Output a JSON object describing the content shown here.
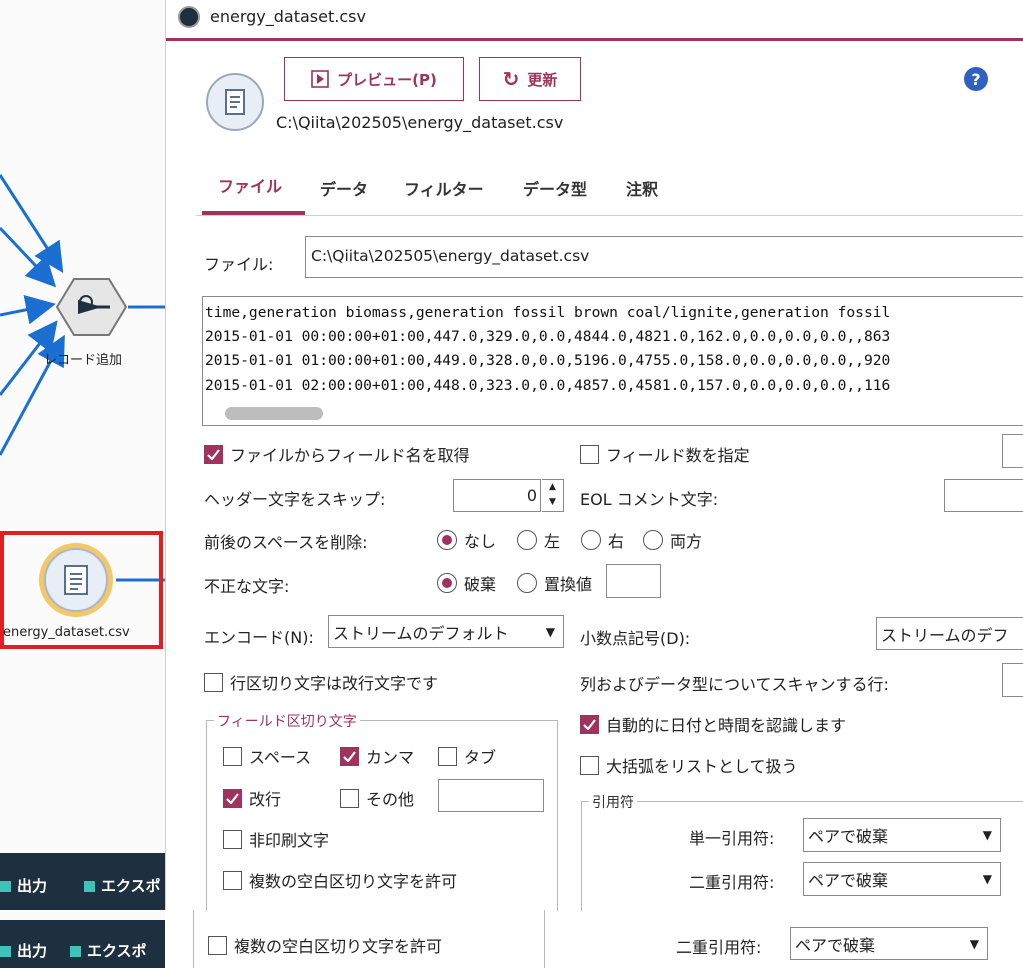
{
  "canvas": {
    "merge_node_label": "レコード追加",
    "source_node_label": "energy_dataset.csv",
    "bottom_bar": {
      "output_label": "出力",
      "export_label": "エクスポ"
    }
  },
  "window": {
    "title": "energy_dataset.csv"
  },
  "toolbar": {
    "preview_label": "プレビュー(P)",
    "refresh_label": "更新",
    "help_label": "?"
  },
  "file_path": "C:\\Qiita\\202505\\energy_dataset.csv",
  "tabs": [
    {
      "label": "ファイル"
    },
    {
      "label": "データ"
    },
    {
      "label": "フィルター"
    },
    {
      "label": "データ型"
    },
    {
      "label": "注釈"
    }
  ],
  "file_field": {
    "label": "ファイル:",
    "value": "C:\\Qiita\\202505\\energy_dataset.csv"
  },
  "preview_lines": [
    "time,generation biomass,generation fossil brown coal/lignite,generation fossil",
    "2015-01-01 00:00:00+01:00,447.0,329.0,0.0,4844.0,4821.0,162.0,0.0,0.0,0.0,,863",
    "2015-01-01 01:00:00+01:00,449.0,328.0,0.0,5196.0,4755.0,158.0,0.0,0.0,0.0,,920",
    "2015-01-01 02:00:00+01:00,448.0,323.0,0.0,4857.0,4581.0,157.0,0.0,0.0,0.0,,116"
  ],
  "options": {
    "get_field_names": {
      "label": "ファイルからフィールド名を取得",
      "checked": true
    },
    "specify_field_count": {
      "label": "フィールド数を指定",
      "checked": false
    },
    "skip_header": {
      "label": "ヘッダー文字をスキップ:",
      "value": "0"
    },
    "eol_comment": {
      "label": "EOL コメント文字:"
    },
    "strip_spaces": {
      "label": "前後のスペースを削除:",
      "choices": [
        "なし",
        "左",
        "右",
        "両方"
      ],
      "selected": "なし"
    },
    "invalid_chars": {
      "label": "不正な文字:",
      "choices": [
        "破棄",
        "置換値"
      ],
      "selected": "破棄"
    },
    "encoding": {
      "label": "エンコード(N):",
      "value": "ストリームのデフォルト"
    },
    "decimal": {
      "label": "小数点記号(D):",
      "value": "ストリームのデフ"
    },
    "line_delimiter_newline": {
      "label": "行区切り文字は改行文字です",
      "checked": false
    },
    "scan_rows": {
      "label": "列およびデータ型についてスキャンする行:"
    },
    "auto_date": {
      "label": "自動的に日付と時間を認識します",
      "checked": true
    },
    "brackets_as_list": {
      "label": "大括弧をリストとして扱う",
      "checked": false
    }
  },
  "field_delimiter": {
    "title": "フィールド区切り文字",
    "space": {
      "label": "スペース",
      "checked": false
    },
    "comma": {
      "label": "カンマ",
      "checked": true
    },
    "tab": {
      "label": "タブ",
      "checked": false
    },
    "newline": {
      "label": "改行",
      "checked": true
    },
    "other": {
      "label": "その他",
      "checked": false
    },
    "nonprint": {
      "label": "非印刷文字",
      "checked": false
    },
    "multi_blank": {
      "label": "複数の空白区切り文字を許可",
      "checked": false
    }
  },
  "quotes": {
    "title": "引用符",
    "single": {
      "label": "単一引用符:",
      "value": "ペアで破棄"
    },
    "double": {
      "label": "二重引用符:",
      "value": "ペアで破棄"
    }
  },
  "ghost": {
    "multi_blank_label": "複数の空白区切り文字を許可",
    "double_label": "二重引用符:",
    "double_value": "ペアで破棄"
  },
  "colors": {
    "accent": "#a0325e",
    "canvas_bar": "#1e2f3f",
    "link": "#1a6fd1",
    "highlight": "#e02020"
  }
}
